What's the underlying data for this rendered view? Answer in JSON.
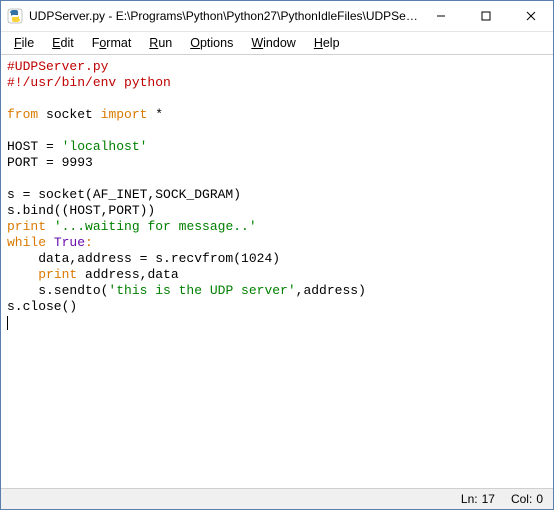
{
  "window": {
    "title": "UDPServer.py - E:\\Programs\\Python\\Python27\\PythonIdleFiles\\UDPSer..."
  },
  "menubar": {
    "items": [
      {
        "underline": "F",
        "rest": "ile"
      },
      {
        "underline": "E",
        "rest": "dit"
      },
      {
        "underline": "F",
        "rest": "ormat",
        "prefix": "",
        "u": "o",
        "pre": "F",
        "post": "rmat"
      },
      {
        "underline": "R",
        "rest": "un"
      },
      {
        "underline": "O",
        "rest": "ptions"
      },
      {
        "underline": "W",
        "rest": "indow"
      },
      {
        "underline": "H",
        "rest": "elp"
      }
    ]
  },
  "code": {
    "l1": "#UDPServer.py",
    "l2": "#!/usr/bin/env python",
    "l3": "",
    "l4_kw": "from",
    "l4_mid": " socket ",
    "l4_kw2": "import",
    "l4_end": " *",
    "l5": "",
    "l6a": "HOST = ",
    "l6b": "'localhost'",
    "l7": "PORT = 9993",
    "l8": "",
    "l9": "s = socket(AF_INET,SOCK_DGRAM)",
    "l10": "s.bind((HOST,PORT))",
    "l11_kw": "print",
    "l11_sp": " ",
    "l11_str": "'...waiting for message..'",
    "l12_kw": "while",
    "l12_sp": " ",
    "l12_true": "True",
    "l12_colon": ":",
    "l13": "    data,address = s.recvfrom(1024)",
    "l14_ind": "    ",
    "l14_kw": "print",
    "l14_rest": " address,data",
    "l15_pre": "    s.sendto(",
    "l15_str": "'this is the UDP server'",
    "l15_post": ",address)",
    "l16": "s.close()"
  },
  "status": {
    "ln_label": "Ln:",
    "ln_value": "17",
    "col_label": "Col:",
    "col_value": "0"
  }
}
